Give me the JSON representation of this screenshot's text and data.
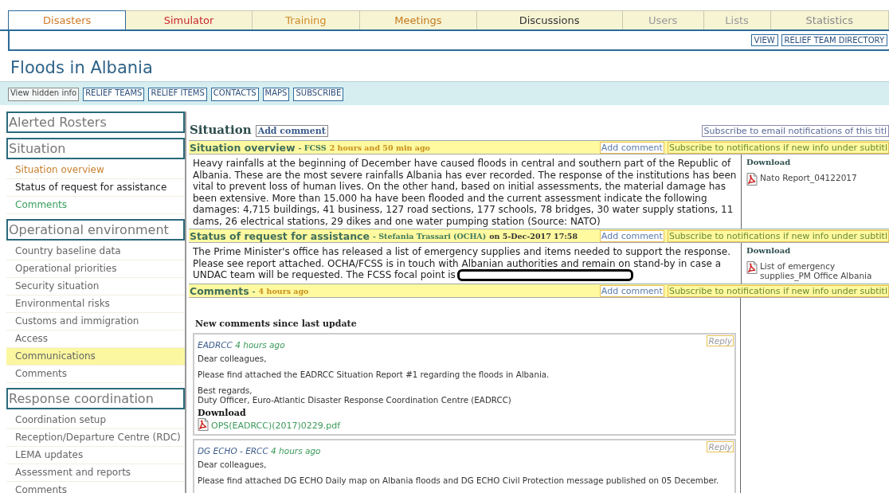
{
  "tabs": [
    {
      "label": "Disasters",
      "selected": true,
      "color": "#d07a25"
    },
    {
      "label": "Simulator",
      "selected": false,
      "color": "#c8282d"
    },
    {
      "label": "Training",
      "selected": false,
      "color": "#d08a28"
    },
    {
      "label": "Meetings",
      "selected": false,
      "color": "#c47a1e"
    },
    {
      "label": "Discussions",
      "selected": false,
      "color": "#333333"
    },
    {
      "label": "Users",
      "selected": false,
      "color": "#999999"
    },
    {
      "label": "Lists",
      "selected": false,
      "color": "#999999"
    },
    {
      "label": "Statistics",
      "selected": false,
      "color": "#888888"
    }
  ],
  "top_actions": [
    "VIEW",
    "RELIEF TEAM DIRECTORY"
  ],
  "title": "Floods in Albania",
  "toolbar": [
    {
      "label": "View hidden info",
      "kind": "plain"
    },
    {
      "label": "RELIEF TEAMS",
      "kind": "boxed"
    },
    {
      "label": "RELIEF ITEMS",
      "kind": "boxed"
    },
    {
      "label": "CONTACTS",
      "kind": "boxed"
    },
    {
      "label": "MAPS",
      "kind": "boxed"
    },
    {
      "label": "SUBSCRIBE",
      "kind": "boxed"
    }
  ],
  "sidebar": [
    {
      "heading": "Alerted Rosters"
    },
    {
      "heading": "Situation",
      "items": [
        {
          "label": "Situation overview",
          "selected": false,
          "color": "#c8802e"
        },
        {
          "label": "Status of request for assistance",
          "selected": false,
          "color": "#222222"
        },
        {
          "label": "Comments",
          "selected": false,
          "color": "#3aa060"
        }
      ]
    },
    {
      "heading": "Operational environment",
      "items": [
        {
          "label": "Country baseline data",
          "selected": false
        },
        {
          "label": "Operational priorities",
          "selected": false
        },
        {
          "label": "Security situation",
          "selected": false
        },
        {
          "label": "Environmental risks",
          "selected": false
        },
        {
          "label": "Customs and immigration",
          "selected": false
        },
        {
          "label": "Access",
          "selected": false
        },
        {
          "label": "Communications",
          "selected": true
        },
        {
          "label": "Comments",
          "selected": false
        }
      ]
    },
    {
      "heading": "Response coordination",
      "items": [
        {
          "label": "Coordination setup",
          "selected": false
        },
        {
          "label": "Reception/Departure Centre (RDC)",
          "selected": false
        },
        {
          "label": "LEMA updates",
          "selected": false
        },
        {
          "label": "Assessment and reports",
          "selected": false
        },
        {
          "label": "Comments",
          "selected": false
        }
      ]
    }
  ],
  "main": {
    "heading": "Situation",
    "add_comment": "Add comment",
    "subscribe": "Subscribe to email notifications of this titl",
    "sections": [
      {
        "title": "Situation overview",
        "meta": [
          {
            "text": "- FCSS",
            "kind": "author"
          },
          {
            "text": "2 hours and 50 min ago",
            "kind": "time"
          }
        ],
        "add_comment": "Add comment",
        "subscribe": "Subscribe to notifications if new info under subtitl",
        "body": "Heavy rainfalls at the beginning of December have caused floods in central and southern part of the Republic of Albania. These are the most severe rainfalls Albania has ever recorded. The response of the institutions has been vital to prevent loss of human lives. On the other hand, based on initial assessments, the material damage has been extensive. More than 15.000 ha have been flooded and the current assessment indicate the following damages: 4,715 buildings, 41 business, 127 road sections, 177 schools, 78 bridges, 30 water supply stations, 11 dams, 26 electrical stations, 29 dikes and one water pumping station (Source: NATO)",
        "download": {
          "heading": "Download",
          "files": [
            "Nato Report_04122017"
          ]
        }
      },
      {
        "title": "Status of request for assistance",
        "meta": [
          {
            "text": "- Stefania Trassari (OCHA)",
            "kind": "author"
          },
          {
            "text": "on 5-Dec-2017 17:58",
            "kind": "date"
          }
        ],
        "add_comment": "Add comment",
        "subscribe": "Subscribe to notifications if new info under subtitl",
        "body": "The Prime Minister's office has released a list of emergency supplies and items needed to support the response. Please see report attached. OCHA/FCSS is in touch with Albanian authorities and remain on stand-by in case a UNDAC team will be requested. The FCSS focal point is",
        "redacted": true,
        "download": {
          "heading": "Download",
          "files": [
            "List of emergency supplies_PM Office Albania"
          ]
        }
      },
      {
        "title": "Comments",
        "meta": [
          {
            "text": "-",
            "kind": "author"
          },
          {
            "text": "4 hours ago",
            "kind": "time"
          }
        ],
        "add_comment": "Add comment",
        "subscribe": "Subscribe to notifications if new info under subtitl",
        "comments": {
          "heading": "New comments since last update",
          "items": [
            {
              "author": "EADRCC",
              "time": "4 hours ago",
              "reply": "Reply",
              "paragraphs": [
                "Dear colleagues,",
                "Please find attached the EADRCC Situation Report #1 regarding the floods in Albania.",
                "Best regards,\nDuty Officer, Euro-Atlantic Disaster Response Coordination Centre (EADRCC)"
              ],
              "download": {
                "heading": "Download",
                "files": [
                  "OPS(EADRCC)(2017)0229.pdf"
                ]
              }
            },
            {
              "author": "DG ECHO - ERCC",
              "time": "4 hours ago",
              "reply": "Reply",
              "paragraphs": [
                "Dear colleagues,",
                "Please find attached DG ECHO Daily map on Albania floods and DG ECHO Civil Protection message published on 05 December."
              ]
            }
          ]
        }
      }
    ]
  }
}
